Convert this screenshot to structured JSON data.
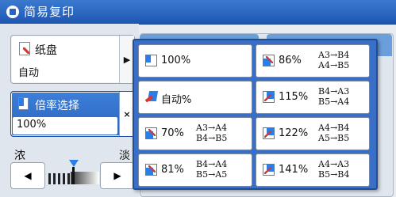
{
  "title": "简易复印",
  "paper": {
    "label": "纸盘",
    "value": "自动"
  },
  "ratio_select": {
    "label": "倍率选择",
    "value": "100%",
    "close": "×"
  },
  "density": {
    "dark_label": "浓",
    "light_label": "淡",
    "left_arrow": "◀",
    "right_arrow": "▶",
    "level": 0.5
  },
  "paper_arrow": "▶",
  "ratios": [
    {
      "pct": "100%",
      "from_to": []
    },
    {
      "pct": "86%",
      "from_to": [
        "A3→B4",
        "A4→B5"
      ]
    },
    {
      "pct": "自动%",
      "from_to": []
    },
    {
      "pct": "115%",
      "from_to": [
        "B4→A3",
        "B5→A4"
      ]
    },
    {
      "pct": "70%",
      "from_to": [
        "A3→A4",
        "B4→B5"
      ]
    },
    {
      "pct": "122%",
      "from_to": [
        "A4→B4",
        "A5→B5"
      ]
    },
    {
      "pct": "81%",
      "from_to": [
        "B4→A4",
        "B5→A5"
      ]
    },
    {
      "pct": "141%",
      "from_to": [
        "A4→A3",
        "B5→B4"
      ]
    }
  ],
  "colors": {
    "title_bar": "#2a63c0",
    "accent": "#2a7ee6",
    "popup_border": "#1e4e9b"
  }
}
